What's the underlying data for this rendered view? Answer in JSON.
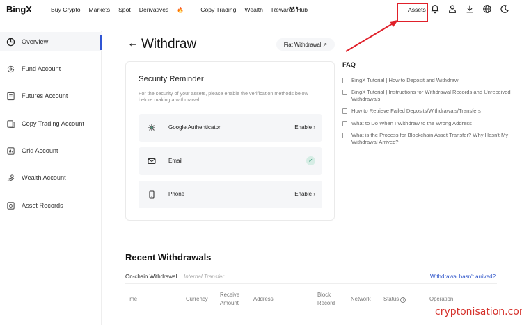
{
  "brand": {
    "logo": "BingX"
  },
  "topnav": {
    "items": [
      "Buy Crypto",
      "Markets",
      "Spot",
      "Derivatives",
      "Copy Trading",
      "Wealth",
      "Rewards Hub"
    ],
    "derivatives_badge": "🔥",
    "more": "•••",
    "assets": "Assets",
    "icons": [
      "bell-icon",
      "user-icon",
      "download-icon",
      "globe-icon",
      "moon-icon"
    ],
    "highlight_color": "#e0202a"
  },
  "sidebar": {
    "items": [
      {
        "label": "Overview",
        "icon": "pie-chart-icon",
        "active": true
      },
      {
        "label": "Fund Account",
        "icon": "fund-icon"
      },
      {
        "label": "Futures Account",
        "icon": "futures-icon"
      },
      {
        "label": "Copy Trading Account",
        "icon": "copy-trading-icon"
      },
      {
        "label": "Grid Account",
        "icon": "grid-icon"
      },
      {
        "label": "Wealth Account",
        "icon": "wealth-icon"
      },
      {
        "label": "Asset Records",
        "icon": "records-icon"
      }
    ],
    "active_color": "#3055d4"
  },
  "main": {
    "title": "Withdraw",
    "fiat_button": "Fiat Withdrawal ↗",
    "security": {
      "title": "Security Reminder",
      "description": "For the security of your assets, please enable the verification methods below before making a withdrawal.",
      "methods": [
        {
          "label": "Google Authenticator",
          "action": "Enable",
          "icon": "authenticator-icon"
        },
        {
          "label": "Email",
          "action": "✓",
          "icon": "mail-icon",
          "enabled": true
        },
        {
          "label": "Phone",
          "action": "Enable",
          "icon": "phone-icon"
        }
      ]
    }
  },
  "faq": {
    "title": "FAQ",
    "items": [
      "BingX Tutorial | How to Deposit and Withdraw",
      "BingX Tutorial | Instructions for Withdrawal Records and Unreceived Withdrawals",
      "How to Retrieve Failed Deposits/Withdrawals/Transfers",
      "What to Do When I Withdraw to the Wrong Address",
      "What is the Process for Blockchain Asset Transfer? Why Hasn't My Withdrawal Arrived?"
    ]
  },
  "recent": {
    "title": "Recent Withdrawals",
    "tabs": [
      "On-chain Withdrawal",
      "Internal Transfer"
    ],
    "link": "Withdrawal hasn't arrived?",
    "columns": [
      "Time",
      "Currency",
      "Receive Amount",
      "Address",
      "Block Record",
      "Network",
      "Status",
      "Operation"
    ],
    "link_color": "#2950c8"
  },
  "watermark": "cryptonisation.com"
}
